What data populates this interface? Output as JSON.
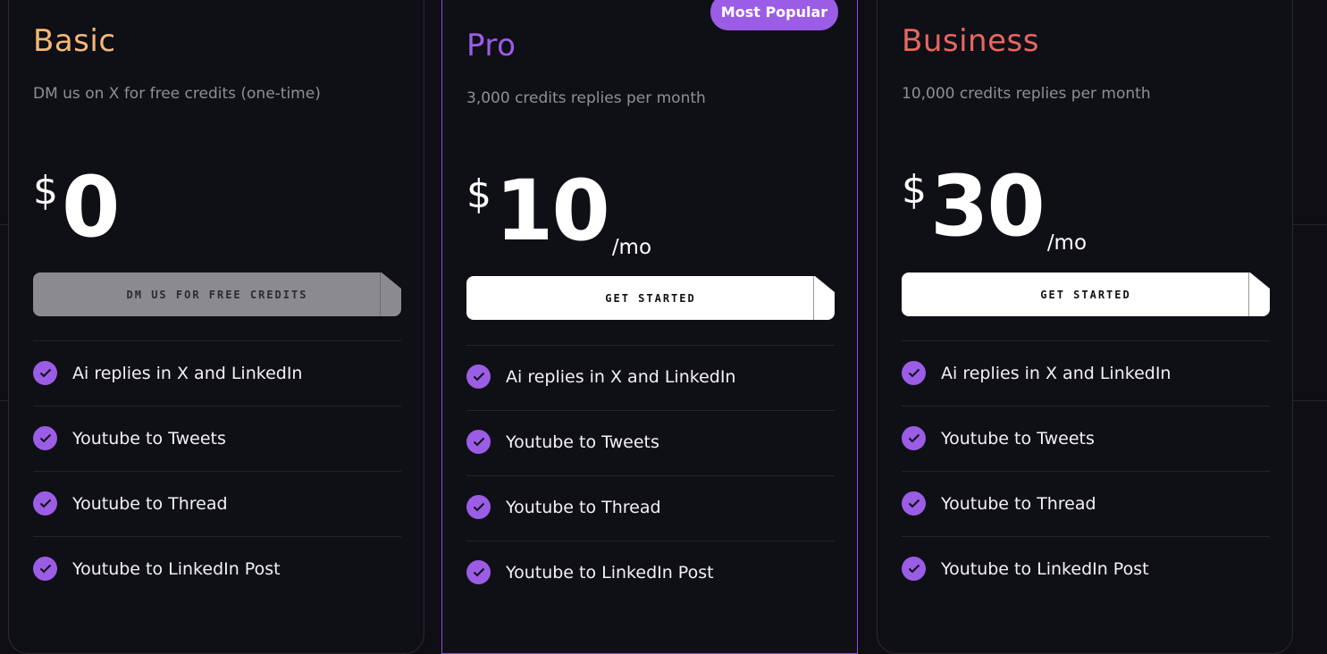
{
  "badge": {
    "label": "Most Popular"
  },
  "colors": {
    "basic": "#f5b878",
    "pro": "#9b5de5",
    "business": "#e8675f",
    "check": "#9b5de5",
    "background": "#0e0e14"
  },
  "plans": [
    {
      "name": "Basic",
      "description": "DM us on X for free credits (one-time)",
      "currency": "$",
      "price": "0",
      "period": "",
      "cta": "DM US FOR FREE CREDITS",
      "features": [
        "Ai replies in X and LinkedIn",
        "Youtube to Tweets",
        "Youtube to Thread",
        "Youtube to LinkedIn Post"
      ]
    },
    {
      "name": "Pro",
      "description": "3,000 credits replies per month",
      "currency": "$",
      "price": "10",
      "period": "/mo",
      "cta": "GET STARTED",
      "features": [
        "Ai replies in X and LinkedIn",
        "Youtube to Tweets",
        "Youtube to Thread",
        "Youtube to LinkedIn Post"
      ]
    },
    {
      "name": "Business",
      "description": "10,000 credits replies per month",
      "currency": "$",
      "price": "30",
      "period": "/mo",
      "cta": "GET STARTED",
      "features": [
        "Ai replies in X and LinkedIn",
        "Youtube to Tweets",
        "Youtube to Thread",
        "Youtube to LinkedIn Post"
      ]
    }
  ],
  "icons": {
    "feature": "check-circle-icon"
  }
}
